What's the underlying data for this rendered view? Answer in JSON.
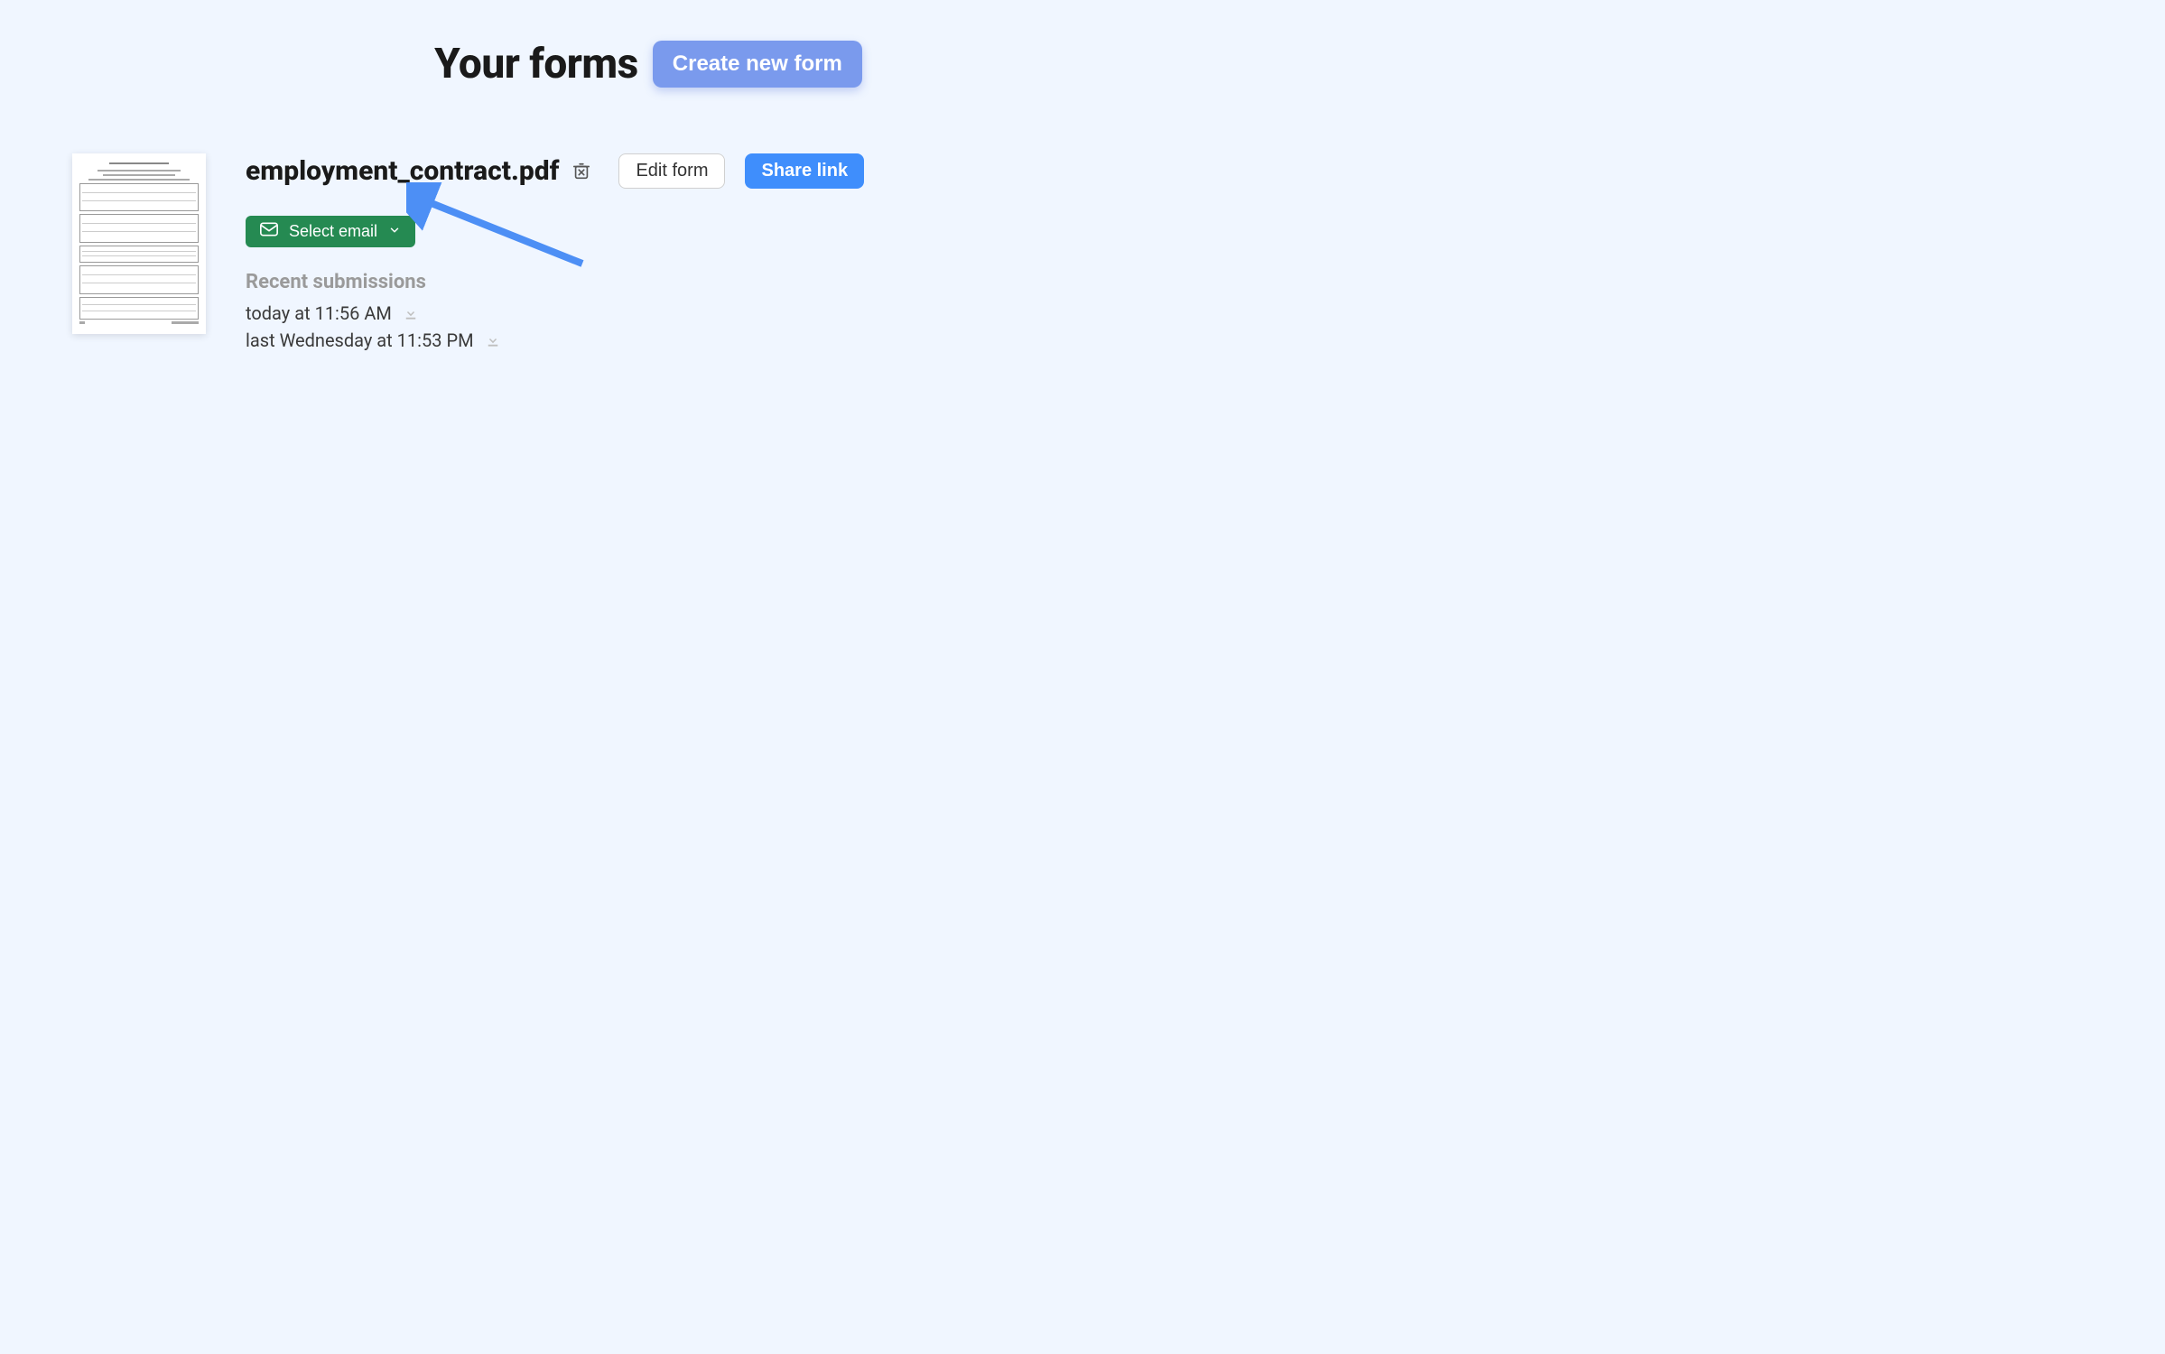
{
  "header": {
    "title": "Your forms",
    "create_label": "Create new form"
  },
  "form": {
    "name": "employment_contract.pdf",
    "edit_label": "Edit form",
    "share_label": "Share link",
    "email_select_label": "Select email"
  },
  "recent": {
    "heading": "Recent submissions",
    "items": [
      {
        "label": "today at 11:56 AM"
      },
      {
        "label": "last Wednesday at 11:53 PM"
      }
    ]
  }
}
